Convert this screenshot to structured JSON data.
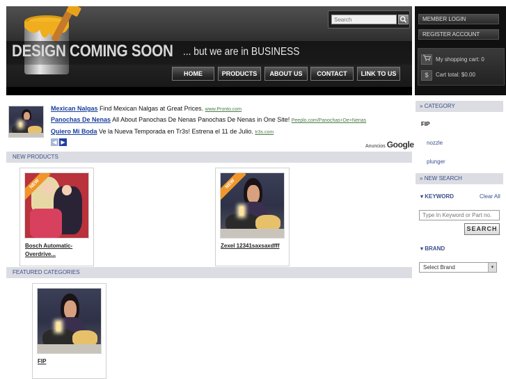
{
  "header": {
    "search_placeholder": "Search",
    "headline_big": "DESIGN COMING SOON",
    "headline_small": "... but we are in BUSINESS",
    "nav": [
      "HOME",
      "PRODUCTS",
      "ABOUT US",
      "CONTACT",
      "LINK TO US"
    ]
  },
  "account": {
    "member_login": "MEMBER LOGIN",
    "register": "REGISTER ACCOUNT",
    "cart_label": "My shopping cart: 0",
    "cart_total": "Cart total: $0.00"
  },
  "ads": {
    "items": [
      {
        "title": "Mexican Nalgas",
        "text": "Find Mexican Nalgas at Great Prices.",
        "url": "www.Pronto.com"
      },
      {
        "title": "Panochas De Nenas",
        "text": "All About Panochas De Nenas Panochas De Nenas in One Site!",
        "url": "Peeplo.com/Panochas+De+Nenas"
      },
      {
        "title": "Quiero Mi Boda",
        "text": "Ve la Nueva Temporada en Tr3s! Estrena el 11 de Julio.",
        "url": "tr3s.com"
      }
    ],
    "ads_by_prefix": "Anuncios",
    "ads_by_brand": "Google"
  },
  "sections": {
    "new_products": "NEW PRODUCTS",
    "featured_categories": "FEATURED CATEGORIES"
  },
  "products": [
    {
      "name": "Bosch Automatic-Overdrive...",
      "badge": "NEW"
    },
    {
      "name": "Zexel 12341saxsaxdfff",
      "badge": "NEW"
    }
  ],
  "featured": [
    {
      "name": "FIP"
    }
  ],
  "sidebar": {
    "category_title": "CATEGORY",
    "categories": [
      "FIP",
      "nozzle",
      "plunger"
    ],
    "new_search_title": "NEW SEARCH",
    "keyword_label": "KEYWORD",
    "clear_all": "Clear All",
    "keyword_placeholder": "Type In Keyword or Part no.",
    "search_button": "SEARCH",
    "brand_label": "BRAND",
    "brand_select": "Select Brand"
  }
}
